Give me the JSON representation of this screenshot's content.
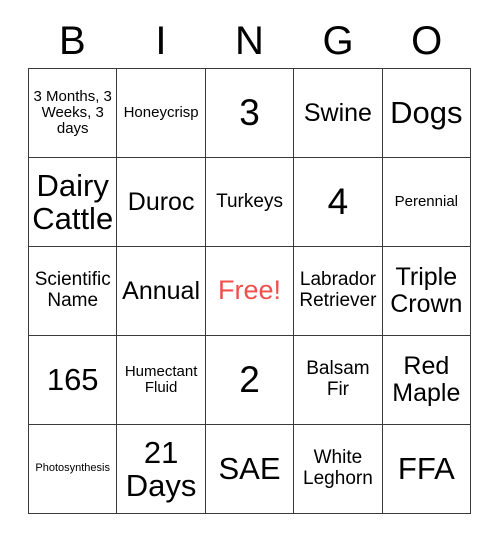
{
  "card": {
    "title_letters": [
      "B",
      "I",
      "N",
      "G",
      "O"
    ],
    "free_color": "#f0504c",
    "border_color": "#3a3a3a",
    "rows": [
      [
        {
          "text": "3 Months, 3 Weeks, 3 days",
          "size": "sm"
        },
        {
          "text": "Honeycrisp",
          "size": "sm"
        },
        {
          "text": "3",
          "size": "xxl"
        },
        {
          "text": "Swine",
          "size": "lg"
        },
        {
          "text": "Dogs",
          "size": "xl"
        }
      ],
      [
        {
          "text": "Dairy Cattle",
          "size": "xl"
        },
        {
          "text": "Duroc",
          "size": "lg"
        },
        {
          "text": "Turkeys",
          "size": "md"
        },
        {
          "text": "4",
          "size": "xxl"
        },
        {
          "text": "Perennial",
          "size": "sm"
        }
      ],
      [
        {
          "text": "Scientific Name",
          "size": "md"
        },
        {
          "text": "Annual",
          "size": "lg"
        },
        {
          "text": "Free!",
          "size": "free"
        },
        {
          "text": "Labrador Retriever",
          "size": "md"
        },
        {
          "text": "Triple Crown",
          "size": "lg"
        }
      ],
      [
        {
          "text": "165",
          "size": "xl"
        },
        {
          "text": "Humectant Fluid",
          "size": "sm"
        },
        {
          "text": "2",
          "size": "xxl"
        },
        {
          "text": "Balsam Fir",
          "size": "md"
        },
        {
          "text": "Red Maple",
          "size": "lg"
        }
      ],
      [
        {
          "text": "Photosynthesis",
          "size": "xs"
        },
        {
          "text": "21 Days",
          "size": "xl"
        },
        {
          "text": "SAE",
          "size": "xl"
        },
        {
          "text": "White Leghorn",
          "size": "md"
        },
        {
          "text": "FFA",
          "size": "xl"
        }
      ]
    ]
  }
}
